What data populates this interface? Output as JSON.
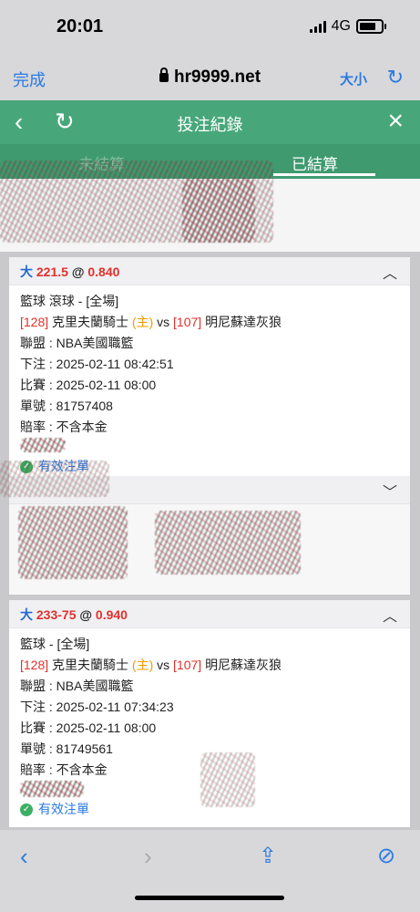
{
  "status": {
    "time": "20:01",
    "network": "4G"
  },
  "browser": {
    "done": "完成",
    "url": "hr9999.net",
    "text_size": "大小"
  },
  "header": {
    "title": "投注紀錄"
  },
  "tabs": [
    {
      "label": "未結算"
    },
    {
      "label": "已結算"
    }
  ],
  "cards": [
    {
      "bet_type": "大",
      "line": "221.5",
      "at": "@",
      "odds": "0.840",
      "sport": "籃球 滾球 - [全場]",
      "home_id": "[128]",
      "home": "克里夫蘭騎士",
      "home_tag": "(主)",
      "vs": "vs",
      "away_id": "[107]",
      "away": "明尼蘇達灰狼",
      "league": "聯盟 : NBA美國職籃",
      "placed": "下注 : 2025-02-11 08:42:51",
      "match": "比賽 : 2025-02-11 08:00",
      "ticket": "單號 : 81757408",
      "payout": "賠率 : 不含本金",
      "status": "有效注單"
    },
    {
      "bet_type": "大",
      "line": "233-75",
      "at": "@",
      "odds": "0.940",
      "sport": "籃球 - [全場]",
      "home_id": "[128]",
      "home": "克里夫蘭騎士",
      "home_tag": "(主)",
      "vs": "vs",
      "away_id": "[107]",
      "away": "明尼蘇達灰狼",
      "league": "聯盟 : NBA美國職籃",
      "placed": "下注 : 2025-02-11 07:34:23",
      "match": "比賽 : 2025-02-11 08:00",
      "ticket": "單號 : 81749561",
      "payout": "賠率 : 不含本金",
      "status": "有效注單"
    }
  ],
  "colors": {
    "header_green": "#48a77a",
    "link_blue": "#2a7ae2",
    "odds_red": "#e0312c",
    "home_orange": "#f39a00"
  }
}
